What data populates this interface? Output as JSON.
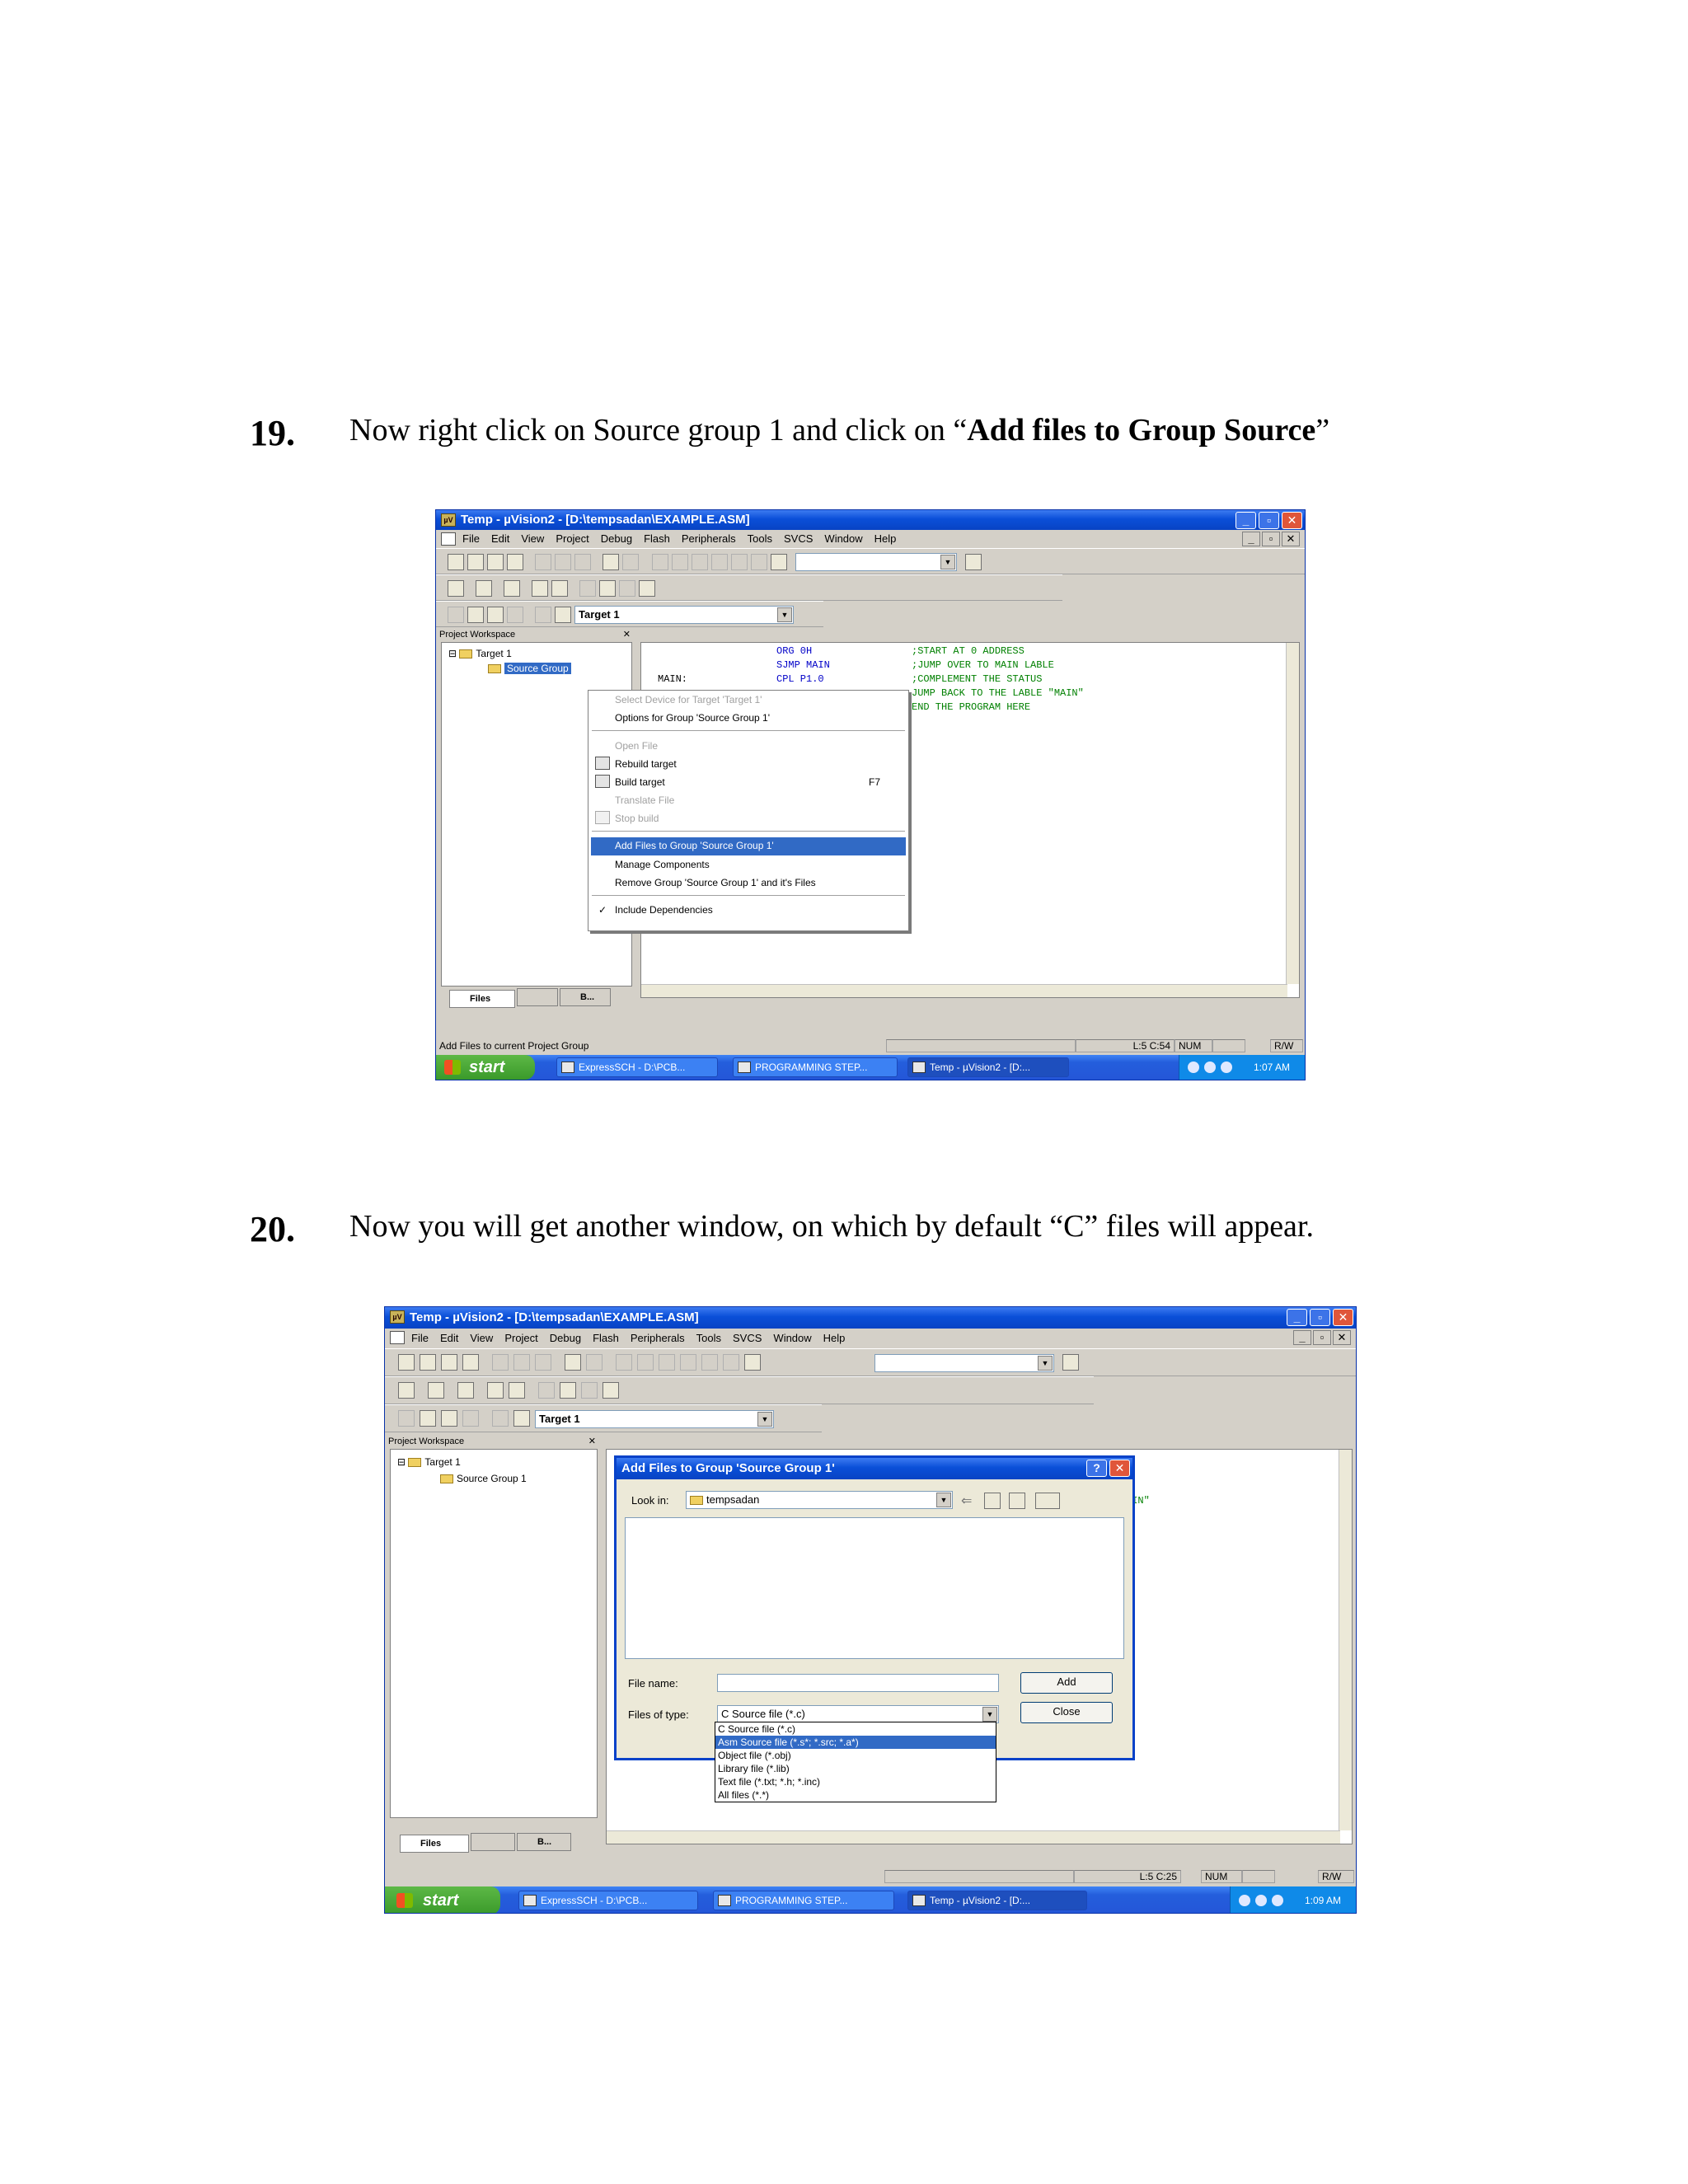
{
  "step19": {
    "number": "19.",
    "text_before": "Now right click on Source group 1 and click on “",
    "text_bold": "Add files to Group Source",
    "text_after": "”"
  },
  "step20": {
    "number": "20.",
    "text": "Now you will get another window, on which by default “C” files will appear."
  },
  "shot1": {
    "window_title": "Temp  - µVision2 - [D:\\tempsadan\\EXAMPLE.ASM]",
    "menu": [
      "File",
      "Edit",
      "View",
      "Project",
      "Debug",
      "Flash",
      "Peripherals",
      "Tools",
      "SVCS",
      "Window",
      "Help"
    ],
    "target_combo": "Target 1",
    "workspace_title": "Project Workspace",
    "tree_target": "Target 1",
    "tree_group": "Source Group",
    "code_lines": [
      {
        "label": "",
        "instr": "ORG 0H",
        "comment": ";START AT 0 ADDRESS"
      },
      {
        "label": "",
        "instr": "SJMP MAIN",
        "comment": ";JUMP OVER TO MAIN LABLE"
      },
      {
        "label": "MAIN:",
        "instr": "CPL P1.0",
        "comment": ";COMPLEMENT THE STATUS"
      },
      {
        "label": "",
        "instr": "",
        "comment": "JUMP BACK TO THE LABLE \"MAIN\""
      },
      {
        "label": "",
        "instr": "",
        "comment": "END THE PROGRAM HERE"
      }
    ],
    "context_menu": {
      "select_device": "Select Device for Target 'Target 1'",
      "options_group": "Options for Group 'Source Group 1'",
      "open_file": "Open File",
      "rebuild": "Rebuild target",
      "build": "Build target",
      "build_key": "F7",
      "translate": "Translate File",
      "stop_build": "Stop build",
      "add_files": "Add Files to Group 'Source Group 1'",
      "manage": "Manage Components",
      "remove": "Remove Group 'Source Group 1' and it's Files",
      "include_deps": "Include Dependencies"
    },
    "tabs": {
      "files": "Files",
      "books": "B..."
    },
    "status": {
      "message": "Add Files to current Project Group",
      "position": "L:5 C:54",
      "num": "NUM",
      "rw": "R/W"
    },
    "taskbar": {
      "start": "start",
      "tasks": [
        "ExpressSCH - D:\\PCB...",
        "PROGRAMMING STEP...",
        "Temp  - µVision2 - [D:..."
      ],
      "time": "1:07 AM"
    }
  },
  "shot2": {
    "window_title": "Temp  - µVision2 - [D:\\tempsadan\\EXAMPLE.ASM]",
    "menu": [
      "File",
      "Edit",
      "View",
      "Project",
      "Debug",
      "Flash",
      "Peripherals",
      "Tools",
      "SVCS",
      "Window",
      "Help"
    ],
    "target_combo": "Target 1",
    "workspace_title": "Project Workspace",
    "tree_target": "Target 1",
    "tree_group": "Source Group 1",
    "partial_code": "AIN\"",
    "dialog": {
      "title": "Add Files to Group 'Source Group 1'",
      "look_in_label": "Look in:",
      "look_in_value": "tempsadan",
      "file_name_label": "File name:",
      "file_name_value": "",
      "files_type_label": "Files of type:",
      "files_type_value": "C Source file (*.c)",
      "add_button": "Add",
      "close_button": "Close",
      "type_options": [
        "C Source file (*.c)",
        "Asm Source file (*.s*; *.src; *.a*)",
        "Object file (*.obj)",
        "Library file (*.lib)",
        "Text file (*.txt; *.h; *.inc)",
        "All files (*.*)"
      ]
    },
    "tabs": {
      "files": "Files",
      "books": "B..."
    },
    "status": {
      "position": "L:5 C:25",
      "num": "NUM",
      "rw": "R/W"
    },
    "taskbar": {
      "start": "start",
      "tasks": [
        "ExpressSCH - D:\\PCB...",
        "PROGRAMMING STEP...",
        "Temp  - µVision2 - [D:..."
      ],
      "time": "1:09 AM"
    }
  }
}
